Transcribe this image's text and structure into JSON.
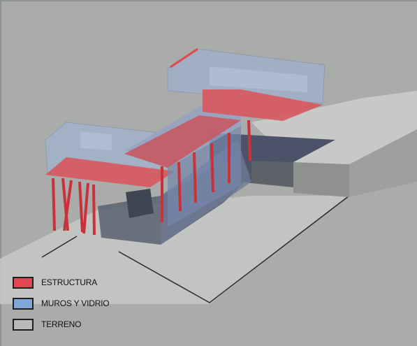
{
  "legend": {
    "items": [
      {
        "label": "ESTRUCTURA",
        "color": "#e0474f"
      },
      {
        "label": "MUROS Y VIDRIO",
        "color": "#7fa6d6"
      },
      {
        "label": "TERRENO",
        "color": "#b7bab7"
      }
    ]
  },
  "colors": {
    "background": "#a9aca8",
    "terrain": "#bfc2be",
    "structure": "#e0474f",
    "glass": "#9fb2d6"
  }
}
